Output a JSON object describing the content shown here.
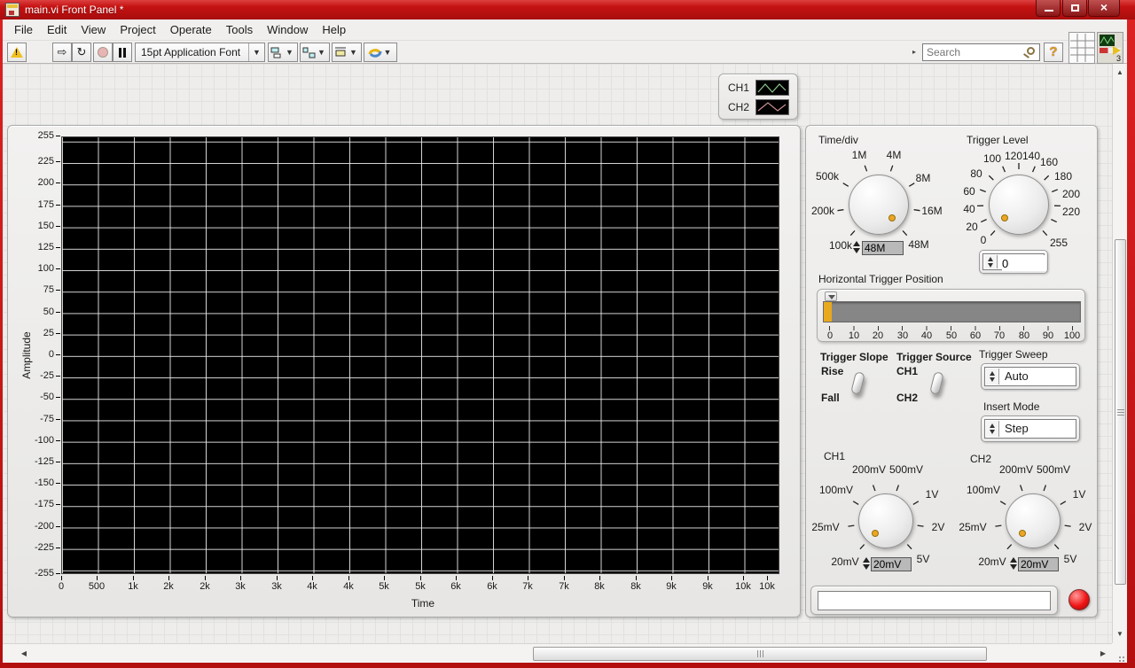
{
  "titlebar": {
    "title": "main.vi Front Panel *"
  },
  "menu": {
    "items": [
      "File",
      "Edit",
      "View",
      "Project",
      "Operate",
      "Tools",
      "Window",
      "Help"
    ]
  },
  "toolbar": {
    "font": "15pt Application Font",
    "search_placeholder": "Search",
    "help": "?",
    "vi_count": "3"
  },
  "legend": {
    "ch1": "CH1",
    "ch2": "CH2"
  },
  "graph": {
    "ylabel": "Amplitude",
    "xlabel": "Time",
    "y_ticks": [
      "255",
      "225",
      "200",
      "175",
      "150",
      "125",
      "100",
      "75",
      "50",
      "25",
      "0",
      "-25",
      "-50",
      "-75",
      "-100",
      "-125",
      "-150",
      "-175",
      "-200",
      "-225",
      "-255"
    ],
    "x_ticks": [
      "0",
      "500",
      "1k",
      "2k",
      "2k",
      "3k",
      "3k",
      "4k",
      "4k",
      "5k",
      "5k",
      "6k",
      "6k",
      "7k",
      "7k",
      "8k",
      "8k",
      "9k",
      "9k",
      "10k",
      "10k"
    ]
  },
  "panel": {
    "timediv": {
      "label": "Time/div",
      "scale": [
        "100k",
        "200k",
        "500k",
        "1M",
        "4M",
        "8M",
        "16M",
        "48M"
      ],
      "value": "48M"
    },
    "trigger_level": {
      "label": "Trigger Level",
      "scale": [
        "0",
        "20",
        "40",
        "60",
        "80",
        "100",
        "120",
        "140",
        "160",
        "180",
        "200",
        "220",
        "255"
      ],
      "value": "0"
    },
    "horizontal_trigger": {
      "label": "Horizontal Trigger Position",
      "ticks": [
        "0",
        "10",
        "20",
        "30",
        "40",
        "50",
        "60",
        "70",
        "80",
        "90",
        "100"
      ]
    },
    "trigger_slope": {
      "label": "Trigger Slope",
      "top": "Rise",
      "bottom": "Fall"
    },
    "trigger_source": {
      "label": "Trigger Source",
      "top": "CH1",
      "bottom": "CH2"
    },
    "trigger_sweep": {
      "label": "Trigger Sweep",
      "value": "Auto"
    },
    "insert_mode": {
      "label": "Insert Mode",
      "value": "Step"
    },
    "ch1": {
      "label": "CH1",
      "scale": [
        "20mV",
        "25mV",
        "100mV",
        "200mV",
        "500mV",
        "1V",
        "2V",
        "5V"
      ],
      "value": "20mV"
    },
    "ch2": {
      "label": "CH2",
      "scale": [
        "20mV",
        "25mV",
        "100mV",
        "200mV",
        "500mV",
        "1V",
        "2V",
        "5V"
      ],
      "value": "20mV"
    },
    "string_input": ""
  },
  "chart_data": {
    "type": "line",
    "title": "",
    "xlabel": "Time",
    "ylabel": "Amplitude",
    "xlim": [
      0,
      10000
    ],
    "ylim": [
      -255,
      255
    ],
    "x_tick_interval": 500,
    "y_tick_interval": 25,
    "grid": true,
    "plot_bg": "#000000",
    "legend_position": "top-right",
    "series": [
      {
        "name": "CH1",
        "color": "#8fc98f",
        "values": []
      },
      {
        "name": "CH2",
        "color": "#c98f8f",
        "values": []
      }
    ]
  }
}
